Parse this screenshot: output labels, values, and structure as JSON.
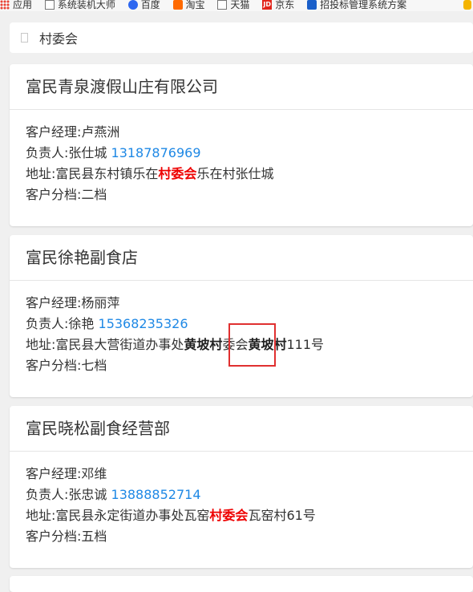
{
  "bookmarks": [
    {
      "label": "应用",
      "icon": "apps-icon"
    },
    {
      "label": "系统装机大师",
      "icon": "page-icon"
    },
    {
      "label": "百度",
      "icon": "baidu-paw-icon"
    },
    {
      "label": "淘宝",
      "icon": "taobao-icon"
    },
    {
      "label": "天猫",
      "icon": "page-icon"
    },
    {
      "label": "京东",
      "icon": "jd-icon"
    },
    {
      "label": "招投标管理系统方案",
      "icon": "paw-icon"
    }
  ],
  "search": {
    "value": "村委会"
  },
  "cards": [
    {
      "title": "富民青泉渡假山庄有限公司",
      "manager_label": "客户经理:",
      "manager": "卢燕洲",
      "person_label": "负责人:",
      "person": "张仕城",
      "phone": "13187876969",
      "address_label": "地址:",
      "addr_pre": "富民县东村镇乐在",
      "addr_hl": "村委会",
      "addr_post": "乐在村张仕城",
      "tier_label": "客户分档:",
      "tier": "二档"
    },
    {
      "title": "富民徐艳副食店",
      "manager_label": "客户经理:",
      "manager": "杨丽萍",
      "person_label": "负责人:",
      "person": "徐艳",
      "phone": "15368235326",
      "address_label": "地址:",
      "addr_pre": "富民县大营街道办事处",
      "addr_hl1": "黄坡村",
      "addr_mid": "委会",
      "addr_hl2": "黄坡村",
      "addr_post": "111号",
      "tier_label": "客户分档:",
      "tier": "七档"
    },
    {
      "title": "富民晓松副食经营部",
      "manager_label": "客户经理:",
      "manager": "邓维",
      "person_label": "负责人:",
      "person": "张忠诚",
      "phone": "13888852714",
      "address_label": "地址:",
      "addr_pre": "富民县永定街道办事处瓦窑",
      "addr_hl": "村委会",
      "addr_post": "瓦窑村61号",
      "tier_label": "客户分档:",
      "tier": "五档"
    }
  ],
  "colors": {
    "highlight_red": "#ee0000",
    "phone_blue": "#1e88e5",
    "marker_red": "#e03030"
  }
}
